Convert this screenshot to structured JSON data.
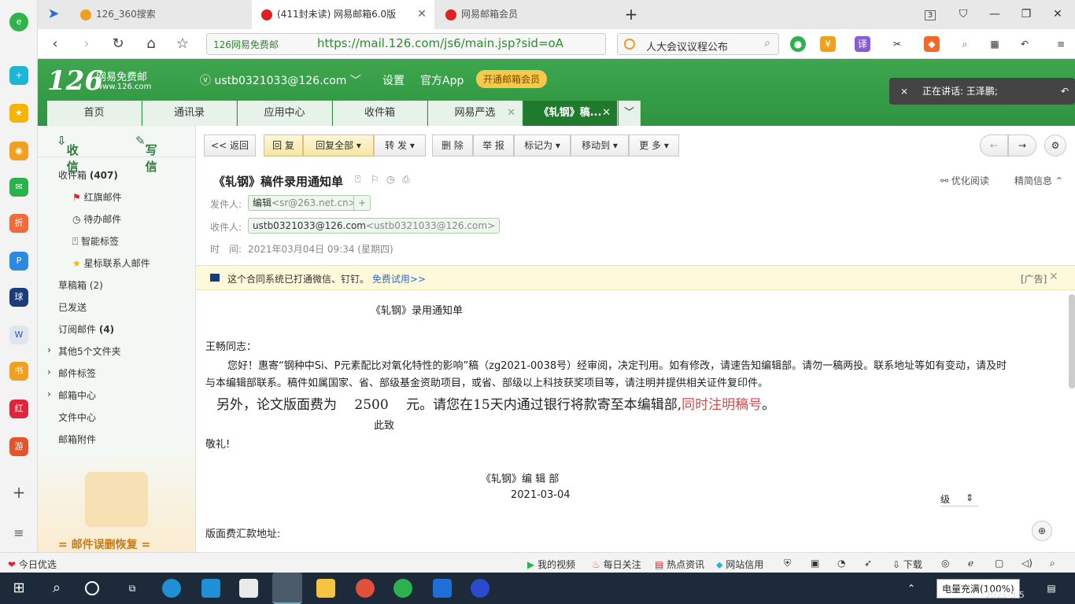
{
  "browser": {
    "tabs": [
      {
        "label": "126_360搜索"
      },
      {
        "label": "(411封未读) 网易邮箱6.0版"
      },
      {
        "label": "网易邮箱会员"
      }
    ],
    "new_tab": "+",
    "tab_count": "3",
    "site_label": "126网易免费邮",
    "url": "https://mail.126.com/js6/main.jsp?sid=oA",
    "search_query": "人大会议议程公布"
  },
  "mail": {
    "logo": "126",
    "logo_sub1": "网易免费邮",
    "logo_sub2": "www.126.com",
    "account": "ustb0321033@126.com",
    "header_links": [
      "设置",
      "官方App"
    ],
    "vip_label": "开通邮箱会员",
    "speaking": "正在讲话: 王泽鹏;",
    "tabs": [
      "首页",
      "通讯录",
      "应用中心",
      "收件箱",
      "网易严选",
      "《轧钢》稿..."
    ],
    "compose": {
      "receive": "收 信",
      "write": "写 信"
    },
    "nav": {
      "inbox": "收件箱",
      "inbox_count": "(407)",
      "flagged": "红旗邮件",
      "todo": "待办邮件",
      "smart": "智能标签",
      "star": "星标联系人邮件",
      "drafts": "草稿箱 (2)",
      "sent": "已发送",
      "subscribe": "订阅邮件",
      "subscribe_count": "(4)",
      "others": "其他5个文件夹",
      "tags": "邮件标签",
      "center": "邮箱中心",
      "files": "文件中心",
      "attachments": "邮箱附件",
      "recover": "= 邮件误删恢复 ="
    },
    "toolbar": [
      "<< 返回",
      "回 复",
      "回复全部",
      "转 发",
      "删 除",
      "举 报",
      "标记为",
      "移动到",
      "更 多"
    ],
    "subject": "《轧钢》稿件录用通知单",
    "reading_opt": "优化阅读",
    "brief_info": "精简信息",
    "from_label": "发件人:",
    "from_name": "编辑",
    "from_addr": "<sr@263.net.cn>",
    "to_label": "收件人:",
    "to_name": "ustb0321033@126.com",
    "to_addr": "<ustb0321033@126.com>",
    "time_label": "时　间:",
    "time_value": "2021年03月04日 09:34 (星期四)",
    "ad_text": "这个合同系统已打通微信、钉钉。",
    "ad_link": "免费试用>>",
    "ad_tag": "[广告]",
    "body": {
      "title": "《轧钢》录用通知单",
      "greeting": "王畅同志：",
      "p1": "您好！惠寄“钢种中Si、P元素配比对氧化特性的影响”稿（zg2021-0038号）经审阅，决定刊用。如有修改，请速告知编辑部。请勿一稿两投。联系地址等如有变动，请及时",
      "p1b": "与本编辑部联系。稿件如属国家、省、部级基金资助项目，或省、部级以上科技获奖项目等，请注明并提供相关证件复印件。",
      "p2a": "另外，论文版面费为　 2500　 元。请您在15天内通过银行将款寄至本编辑部,",
      "p2b": "同时注明稿号",
      "p2c": "。",
      "closing1": "此致",
      "closing2": "敬礼!",
      "sign": "《轧钢》编 辑 部",
      "date": "2021-03-04",
      "level": "级",
      "remit": "版面费汇款地址:"
    }
  },
  "status_bar": {
    "left": "今日优选",
    "items": [
      "我的视频",
      "每日关注",
      "热点资讯",
      "网站信用",
      "下载"
    ]
  },
  "taskbar": {
    "battery_tip": "电量充满(100%)",
    "date": "2021-3-5"
  }
}
